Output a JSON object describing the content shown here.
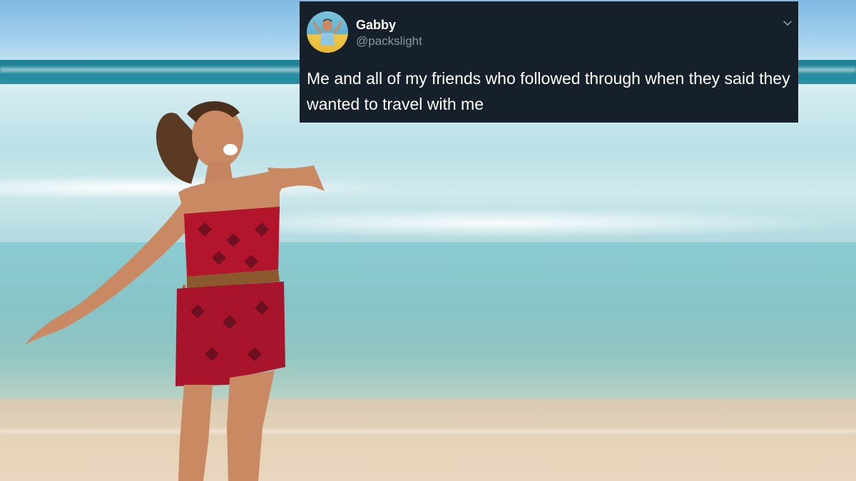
{
  "tweet": {
    "author_name": "Gabby",
    "author_handle": "@packslight",
    "text": "Me and all of my friends who followed through when they said they wanted to travel with me",
    "menu_icon": "chevron-down-icon",
    "avatar_icon": "avatar"
  },
  "colors": {
    "tweet_background": "#15202b",
    "name_text": "#ffffff",
    "handle_text": "#8899a6",
    "body_text": "#ffffff"
  }
}
